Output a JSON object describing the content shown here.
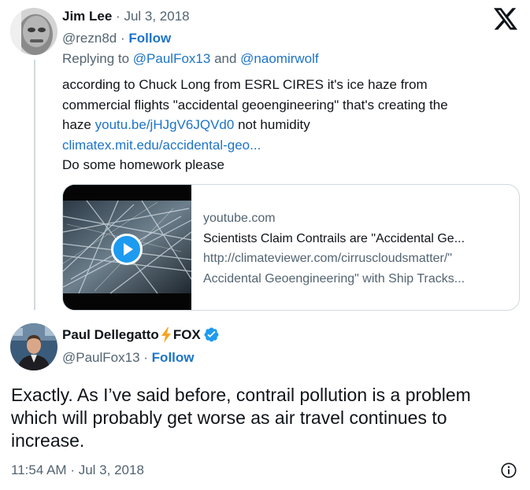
{
  "reply": {
    "author_name": "Jim Lee",
    "separator": "·",
    "date": "Jul 3, 2018",
    "handle": "@rezn8d",
    "follow_label": "Follow",
    "replying_prefix": "Replying to",
    "replying_user1": "@PaulFox13",
    "replying_and": "and",
    "replying_user2": "@naomirwolf",
    "body_line1": "according to Chuck Long from ESRL CIRES it's ice haze from",
    "body_line2": "commercial flights \"accidental geoengineering\" that's creating the",
    "body_line3_pre": "haze",
    "body_link1": "youtu.be/jHJgV6JQVd0",
    "body_line3_post": "not humidity",
    "body_link2": "climatex.mit.edu/accidental-geo...",
    "body_line5": "Do some homework please"
  },
  "link_card": {
    "domain": "youtube.com",
    "title": "Scientists Claim Contrails are \"Accidental Ge...",
    "description_line1": "http://climateviewer.com/cirruscloudsmatter/\"",
    "description_line2": "Accidental Geoengineering\" with Ship Tracks..."
  },
  "main_tweet": {
    "author_name": "Paul Dellegatto",
    "name_suffix": "FOX",
    "handle": "@PaulFox13",
    "separator": "·",
    "follow_label": "Follow",
    "body_line1": "Exactly. As I’ve said before, contrail pollution is a problem",
    "body_line2": "which will probably get worse as air travel continues to",
    "body_line3": "increase.",
    "time": "11:54 AM",
    "date": "Jul 3, 2018"
  },
  "icons": {
    "brand": "x-logo-icon",
    "verified": "verified-badge-icon",
    "bolt": "lightning-bolt-icon",
    "play": "play-icon",
    "info": "info-icon"
  },
  "colors": {
    "link": "#1d74c8",
    "muted": "#536471",
    "verified": "#1d9bf0",
    "bolt": "#f5a623"
  }
}
